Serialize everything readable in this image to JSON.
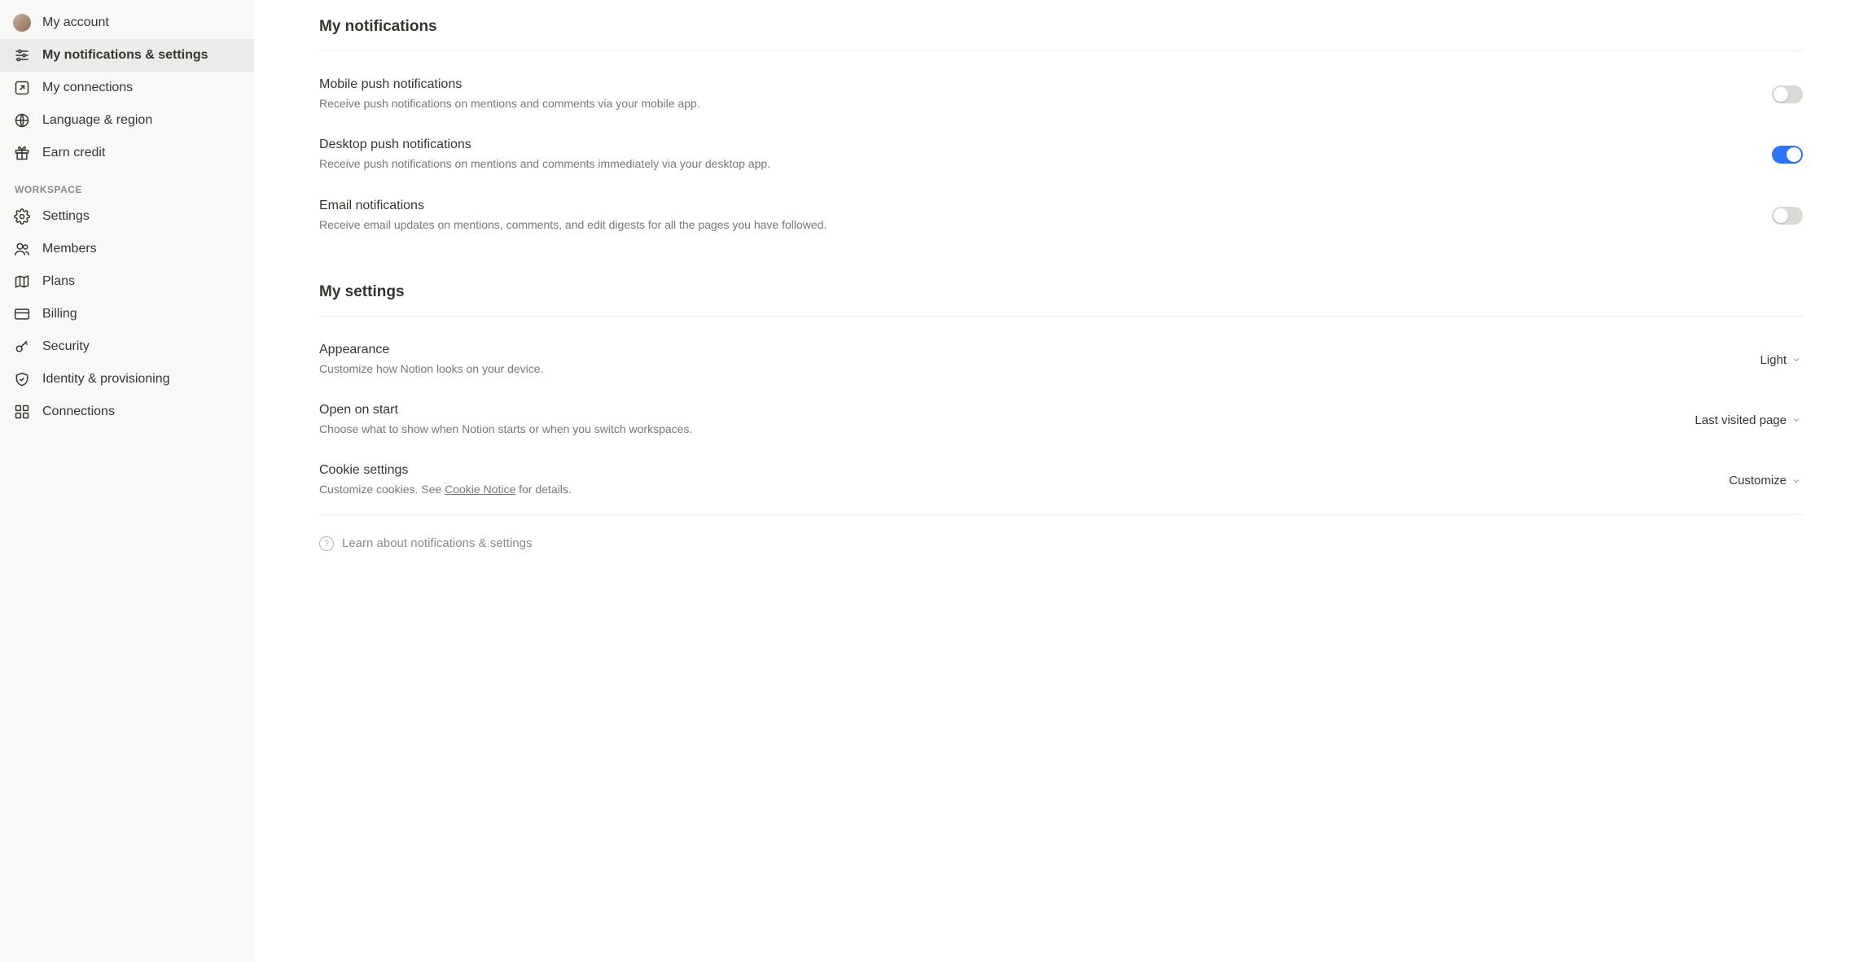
{
  "sidebar": {
    "account": [
      {
        "label": "My account"
      },
      {
        "label": "My notifications & settings"
      },
      {
        "label": "My connections"
      },
      {
        "label": "Language & region"
      },
      {
        "label": "Earn credit"
      }
    ],
    "workspace_label": "WORKSPACE",
    "workspace": [
      {
        "label": "Settings"
      },
      {
        "label": "Members"
      },
      {
        "label": "Plans"
      },
      {
        "label": "Billing"
      },
      {
        "label": "Security"
      },
      {
        "label": "Identity & provisioning"
      },
      {
        "label": "Connections"
      }
    ]
  },
  "notifications": {
    "title": "My notifications",
    "mobile": {
      "title": "Mobile push notifications",
      "desc": "Receive push notifications on mentions and comments via your mobile app.",
      "on": false
    },
    "desktop": {
      "title": "Desktop push notifications",
      "desc": "Receive push notifications on mentions and comments immediately via your desktop app.",
      "on": true
    },
    "email": {
      "title": "Email notifications",
      "desc": "Receive email updates on mentions, comments, and edit digests for all the pages you have followed.",
      "on": false
    }
  },
  "settings": {
    "title": "My settings",
    "appearance": {
      "title": "Appearance",
      "desc": "Customize how Notion looks on your device.",
      "value": "Light"
    },
    "open_on_start": {
      "title": "Open on start",
      "desc": "Choose what to show when Notion starts or when you switch workspaces.",
      "value": "Last visited page"
    },
    "cookie": {
      "title": "Cookie settings",
      "desc_prefix": "Customize cookies. See ",
      "desc_link": "Cookie Notice",
      "desc_suffix": " for details.",
      "value": "Customize"
    }
  },
  "help_link": "Learn about notifications & settings"
}
